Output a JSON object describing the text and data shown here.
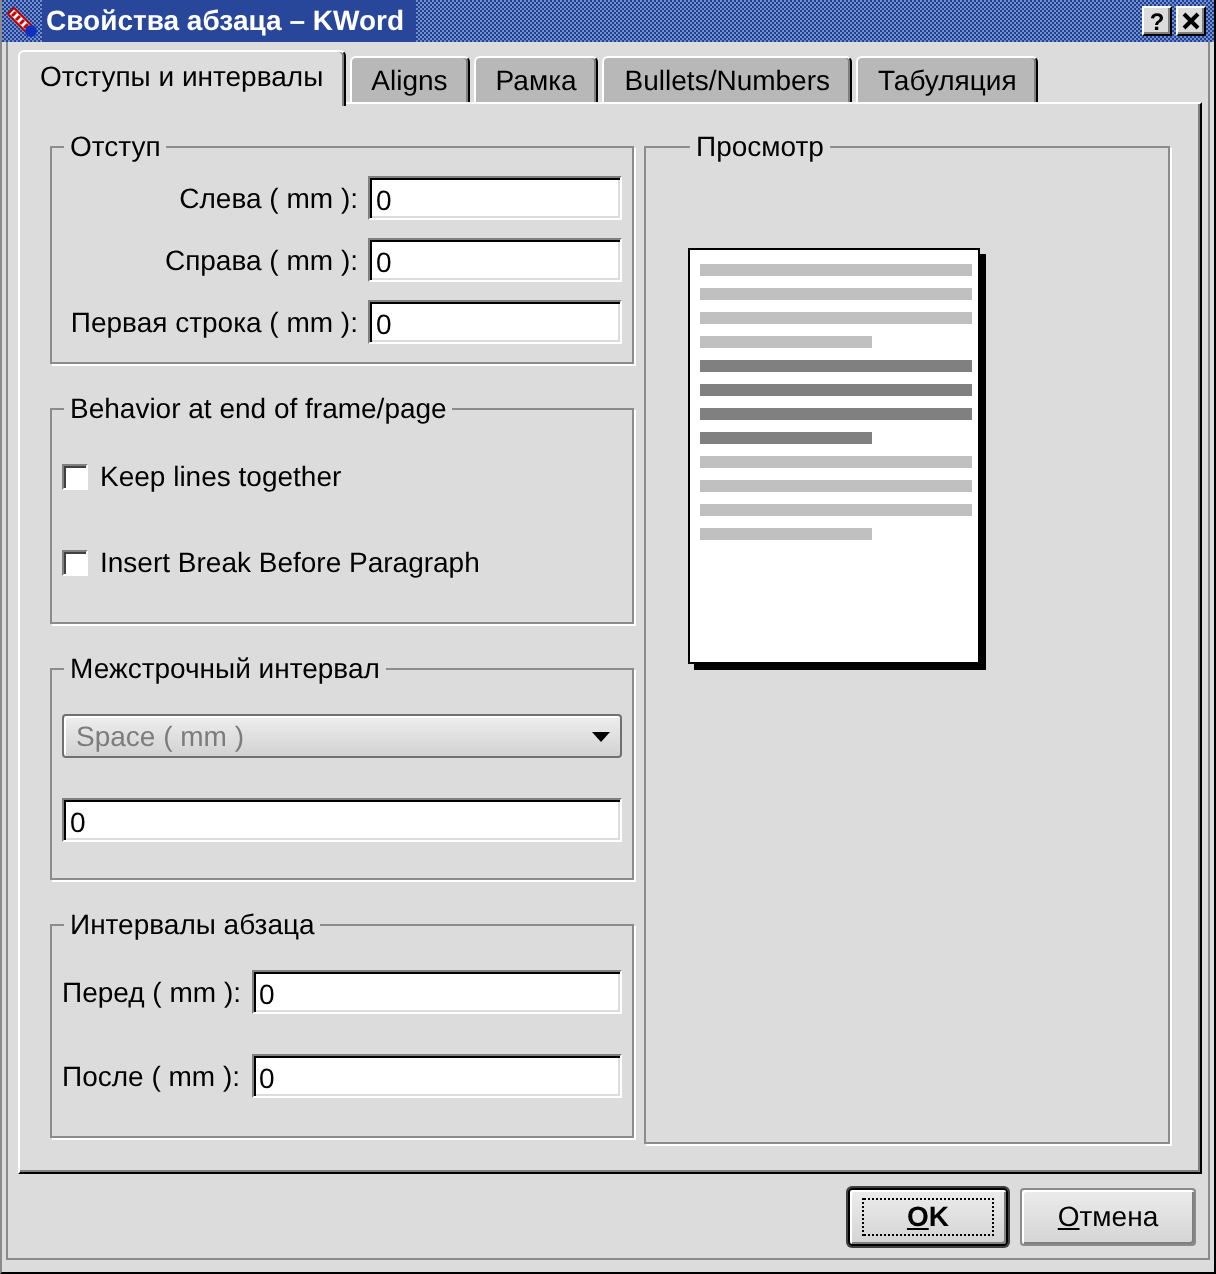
{
  "window": {
    "title": "Свойства абзаца – KWord",
    "help_button": "?"
  },
  "tabs": [
    {
      "label": "Отступы и интервалы",
      "selected": true
    },
    {
      "label": "Aligns",
      "selected": false
    },
    {
      "label": "Рамка",
      "selected": false
    },
    {
      "label": "Bullets/Numbers",
      "selected": false
    },
    {
      "label": "Табуляция",
      "selected": false
    }
  ],
  "indent": {
    "title": "Отступ",
    "fields": [
      {
        "label": "Слева ( mm ):",
        "value": "0"
      },
      {
        "label": "Справа ( mm ):",
        "value": "0"
      },
      {
        "label": "Первая строка ( mm ):",
        "value": "0"
      }
    ]
  },
  "behavior": {
    "title": "Behavior at end of frame/page",
    "options": [
      {
        "label": "Keep lines together",
        "checked": false
      },
      {
        "label": "Insert Break Before Paragraph",
        "checked": false
      }
    ]
  },
  "line_spacing": {
    "title": "Межстрочный интервал",
    "dropdown": {
      "value": "Space ( mm )",
      "disabled": true
    },
    "value": "0"
  },
  "paragraph_spacing": {
    "title": "Интервалы абзаца",
    "fields": [
      {
        "label": "Перед ( mm ):",
        "value": "0"
      },
      {
        "label": "После ( mm ):",
        "value": "0"
      }
    ]
  },
  "preview": {
    "title": "Просмотр"
  },
  "buttons": [
    {
      "label": "OK",
      "default": true
    },
    {
      "label": "Отмена",
      "default": false
    }
  ]
}
